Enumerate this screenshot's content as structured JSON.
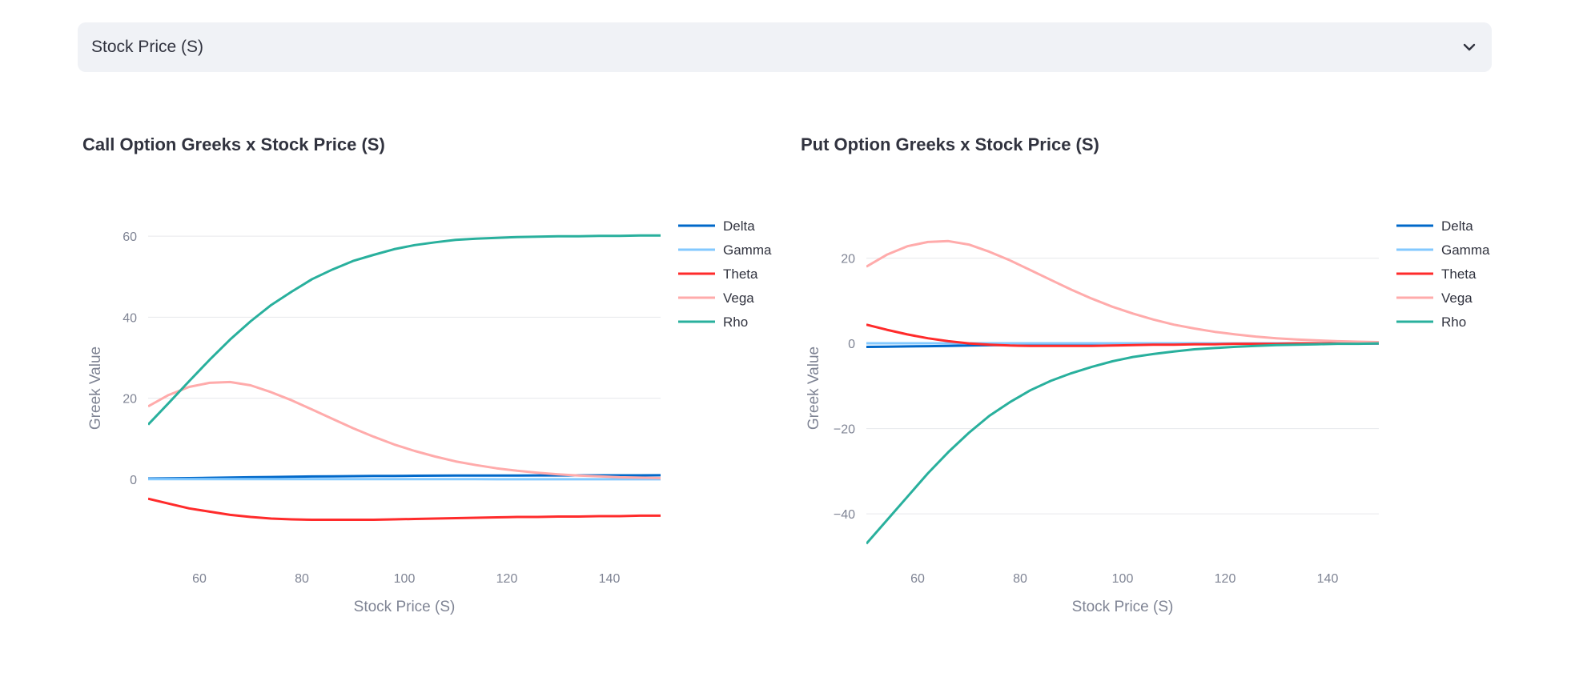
{
  "selector": {
    "value": "Stock Price (S)",
    "icon": "chevron-down-icon"
  },
  "chart_data": [
    {
      "type": "line",
      "title": "Call Option Greeks x Stock Price (S)",
      "xlabel": "Stock Price (S)",
      "ylabel": "Greek Value",
      "xlim": [
        50,
        150
      ],
      "ylim": [
        -18,
        63
      ],
      "xticks": [
        60,
        80,
        100,
        120,
        140
      ],
      "yticks": [
        0,
        20,
        40,
        60
      ],
      "grid": true,
      "legend": "top-right",
      "x": [
        50,
        54,
        58,
        62,
        66,
        70,
        74,
        78,
        82,
        86,
        90,
        94,
        98,
        102,
        106,
        110,
        114,
        118,
        122,
        126,
        130,
        134,
        138,
        142,
        146,
        150
      ],
      "series": [
        {
          "name": "Delta",
          "color": "#0068c9",
          "values": [
            0.18,
            0.22,
            0.28,
            0.35,
            0.42,
            0.49,
            0.56,
            0.62,
            0.68,
            0.73,
            0.77,
            0.8,
            0.83,
            0.86,
            0.88,
            0.9,
            0.91,
            0.92,
            0.93,
            0.94,
            0.95,
            0.96,
            0.96,
            0.97,
            0.97,
            0.98
          ]
        },
        {
          "name": "Gamma",
          "color": "#83c9ff",
          "values": [
            0.02,
            0.02,
            0.02,
            0.02,
            0.02,
            0.02,
            0.02,
            0.02,
            0.02,
            0.01,
            0.01,
            0.01,
            0.01,
            0.01,
            0.01,
            0.01,
            0.01,
            0.0,
            0.0,
            0.0,
            0.0,
            0.0,
            0.0,
            0.0,
            0.0,
            0.0
          ]
        },
        {
          "name": "Theta",
          "color": "#ff2b2b",
          "values": [
            -4.8,
            -6.0,
            -7.2,
            -8.0,
            -8.8,
            -9.3,
            -9.7,
            -9.9,
            -10.0,
            -10.0,
            -10.0,
            -10.0,
            -9.9,
            -9.8,
            -9.7,
            -9.6,
            -9.5,
            -9.4,
            -9.3,
            -9.3,
            -9.2,
            -9.2,
            -9.1,
            -9.1,
            -9.0,
            -9.0
          ]
        },
        {
          "name": "Vega",
          "color": "#ffabab",
          "values": [
            18.0,
            20.8,
            22.8,
            23.8,
            24.0,
            23.2,
            21.5,
            19.5,
            17.2,
            14.9,
            12.6,
            10.5,
            8.6,
            7.0,
            5.6,
            4.4,
            3.5,
            2.7,
            2.1,
            1.6,
            1.2,
            0.9,
            0.7,
            0.5,
            0.4,
            0.3
          ]
        },
        {
          "name": "Rho",
          "color": "#29b09d",
          "values": [
            13.5,
            18.8,
            24.2,
            29.5,
            34.5,
            39.0,
            43.0,
            46.3,
            49.4,
            51.8,
            53.9,
            55.4,
            56.8,
            57.8,
            58.5,
            59.1,
            59.4,
            59.6,
            59.8,
            59.9,
            60.0,
            60.0,
            60.1,
            60.1,
            60.2,
            60.2
          ]
        }
      ]
    },
    {
      "type": "line",
      "title": "Put Option Greeks x Stock Price (S)",
      "xlabel": "Stock Price (S)",
      "ylabel": "Greek Value",
      "xlim": [
        50,
        150
      ],
      "ylim": [
        -49,
        28
      ],
      "xticks": [
        60,
        80,
        100,
        120,
        140
      ],
      "yticks": [
        -40,
        -20,
        0,
        20
      ],
      "grid": true,
      "legend": "top-right",
      "x": [
        50,
        54,
        58,
        62,
        66,
        70,
        74,
        78,
        82,
        86,
        90,
        94,
        98,
        102,
        106,
        110,
        114,
        118,
        122,
        126,
        130,
        134,
        138,
        142,
        146,
        150
      ],
      "series": [
        {
          "name": "Delta",
          "color": "#0068c9",
          "values": [
            -0.82,
            -0.78,
            -0.72,
            -0.65,
            -0.58,
            -0.51,
            -0.44,
            -0.38,
            -0.32,
            -0.27,
            -0.23,
            -0.2,
            -0.17,
            -0.14,
            -0.12,
            -0.1,
            -0.09,
            -0.08,
            -0.07,
            -0.06,
            -0.05,
            -0.04,
            -0.04,
            -0.03,
            -0.03,
            -0.02
          ]
        },
        {
          "name": "Gamma",
          "color": "#83c9ff",
          "values": [
            0.02,
            0.02,
            0.02,
            0.02,
            0.02,
            0.02,
            0.02,
            0.02,
            0.02,
            0.01,
            0.01,
            0.01,
            0.01,
            0.01,
            0.01,
            0.01,
            0.01,
            0.0,
            0.0,
            0.0,
            0.0,
            0.0,
            0.0,
            0.0,
            0.0,
            0.0
          ]
        },
        {
          "name": "Theta",
          "color": "#ff2b2b",
          "values": [
            4.4,
            3.2,
            2.1,
            1.2,
            0.5,
            0.0,
            -0.3,
            -0.5,
            -0.6,
            -0.6,
            -0.6,
            -0.6,
            -0.5,
            -0.4,
            -0.3,
            -0.3,
            -0.2,
            -0.2,
            -0.1,
            -0.1,
            -0.1,
            0.0,
            0.0,
            0.0,
            0.0,
            0.0
          ]
        },
        {
          "name": "Vega",
          "color": "#ffabab",
          "values": [
            18.0,
            20.8,
            22.8,
            23.8,
            24.0,
            23.2,
            21.5,
            19.5,
            17.2,
            14.9,
            12.6,
            10.5,
            8.6,
            7.0,
            5.6,
            4.4,
            3.5,
            2.7,
            2.1,
            1.6,
            1.2,
            0.9,
            0.7,
            0.5,
            0.4,
            0.3
          ]
        },
        {
          "name": "Rho",
          "color": "#29b09d",
          "values": [
            -47.0,
            -41.5,
            -36.0,
            -30.5,
            -25.5,
            -21.0,
            -17.0,
            -13.8,
            -11.0,
            -8.8,
            -7.0,
            -5.5,
            -4.2,
            -3.2,
            -2.5,
            -1.9,
            -1.4,
            -1.1,
            -0.8,
            -0.6,
            -0.4,
            -0.3,
            -0.2,
            -0.1,
            -0.1,
            0.0
          ]
        }
      ]
    }
  ]
}
